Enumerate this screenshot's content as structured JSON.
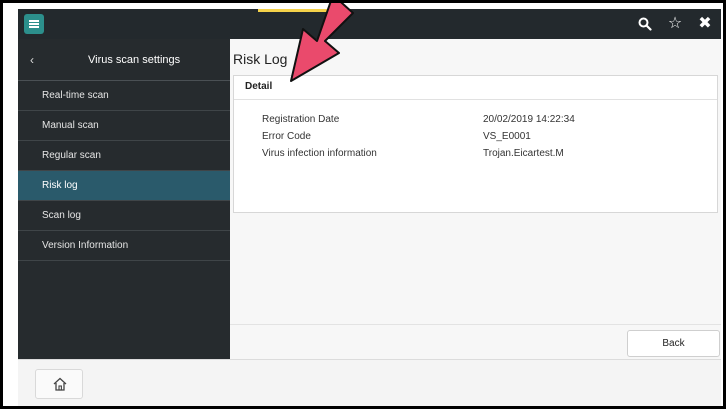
{
  "header": {
    "icons": [
      "menu-icon",
      "search-icon",
      "star-icon",
      "close-icon"
    ],
    "search_glyph": "🔍",
    "star_glyph": "☆",
    "close_glyph": "✖"
  },
  "sidebar": {
    "back_glyph": "‹",
    "title": "Virus scan settings",
    "items": [
      {
        "label": "Real-time scan"
      },
      {
        "label": "Manual scan"
      },
      {
        "label": "Regular scan"
      },
      {
        "label": "Risk log",
        "active": true
      },
      {
        "label": "Scan log"
      },
      {
        "label": "Version Information"
      }
    ]
  },
  "main": {
    "title": "Risk Log",
    "detail": {
      "header": "Detail",
      "rows": [
        {
          "key": "Registration Date",
          "value": "20/02/2019 14:22:34"
        },
        {
          "key": "Error Code",
          "value": "VS_E0001"
        },
        {
          "key": "Virus infection information",
          "value": "Trojan.Eicartest.M"
        }
      ]
    },
    "back_label": "Back"
  },
  "footer": {
    "home_icon": "home-icon"
  },
  "colors": {
    "topbar": "#23292d",
    "sidebar": "#262b2e",
    "active_item": "#2a5a6b",
    "menu_button": "#2c8f8c",
    "arrow": "#ea4a6c",
    "highlight": "#f5d24a"
  }
}
